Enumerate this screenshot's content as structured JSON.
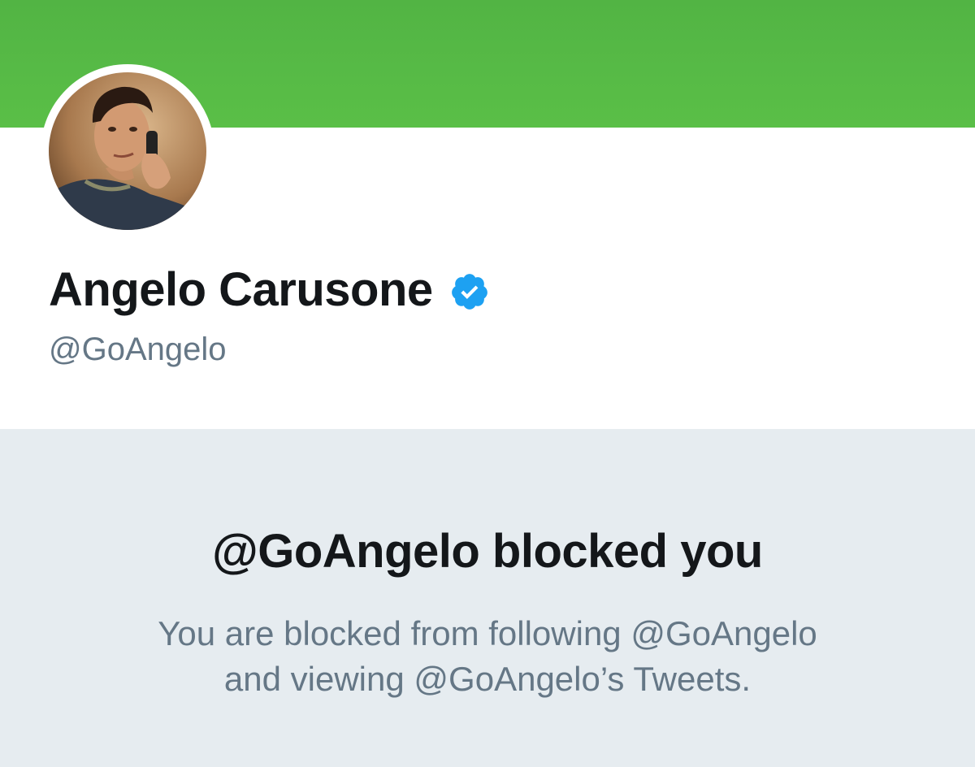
{
  "profile": {
    "display_name": "Angelo Carusone",
    "handle": "@GoAngelo",
    "verified_icon": "verified-badge-icon",
    "banner_color": "#56b946",
    "verified_color": "#1da1f2"
  },
  "blocked": {
    "title": "@GoAngelo blocked you",
    "description_line1": "You are blocked from following @GoAngelo",
    "description_line2": "and viewing @GoAngelo’s Tweets."
  },
  "colors": {
    "name_text": "#14171a",
    "secondary_text": "#657786",
    "panel_background": "#e6ecf0"
  }
}
